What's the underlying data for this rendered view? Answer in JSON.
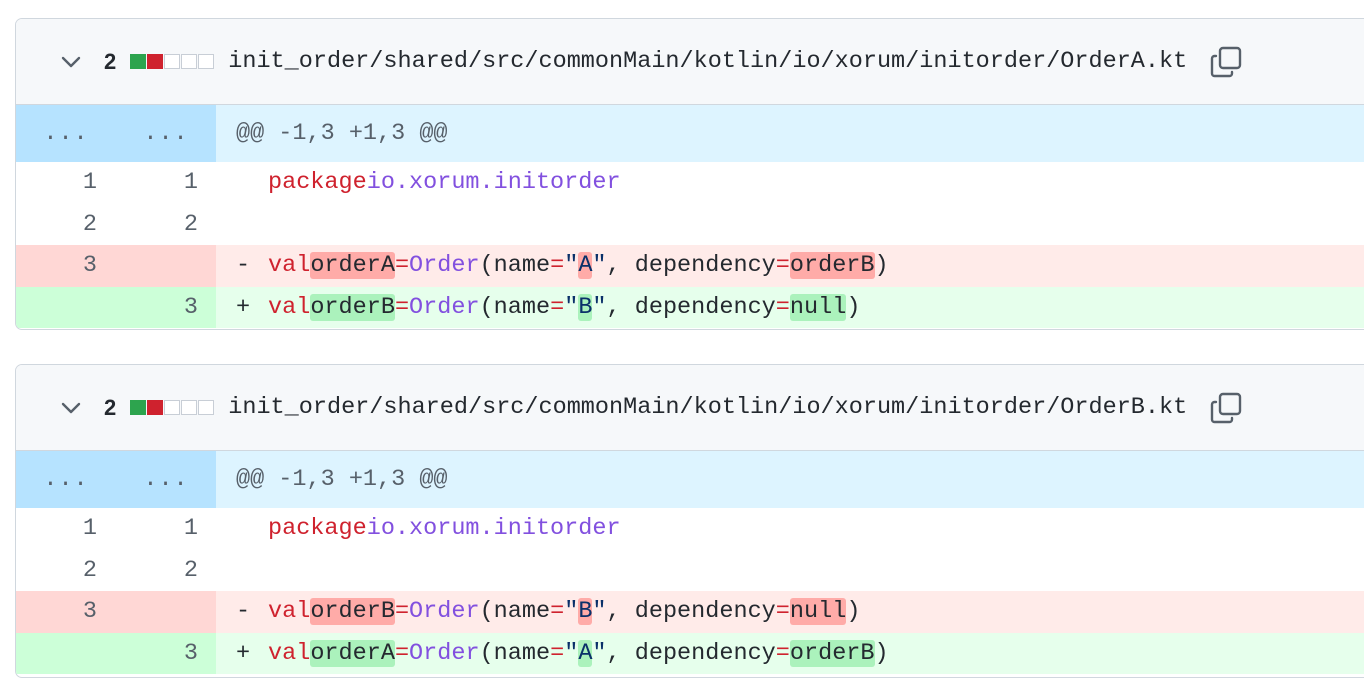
{
  "files": [
    {
      "change_count": "2",
      "diffstat": [
        "add",
        "del",
        "neutral",
        "neutral",
        "neutral"
      ],
      "path": "init_order/shared/src/commonMain/kotlin/io/xorum/initorder/OrderA.kt",
      "copy_icon": "copy-icon",
      "expand_icon": "chevron-down-icon",
      "hunk": {
        "old": "...",
        "new": "...",
        "header": "@@ -1,3 +1,3 @@"
      },
      "lines": [
        {
          "old": "1",
          "new": "1",
          "marker": " ",
          "package_kw": "package",
          "package_name": "io.xorum.initorder"
        },
        {
          "old": "2",
          "new": "2",
          "marker": " "
        },
        {
          "old": "3",
          "new": "",
          "marker": "-",
          "val": "val",
          "name": "orderA",
          "eq": "=",
          "ctor": "Order",
          "arg1": "name",
          "str_q1": "\"",
          "str_v": "A",
          "str_q2": "\"",
          "arg2": "dependency",
          "dep": "orderB",
          "open": "(",
          "close": ")",
          "comma": ", "
        },
        {
          "old": "",
          "new": "3",
          "marker": "+",
          "val": "val",
          "name": "orderB",
          "eq": "=",
          "ctor": "Order",
          "arg1": "name",
          "str_q1": "\"",
          "str_v": "B",
          "str_q2": "\"",
          "arg2": "dependency",
          "dep": "null",
          "open": "(",
          "close": ")",
          "comma": ", "
        }
      ]
    },
    {
      "change_count": "2",
      "diffstat": [
        "add",
        "del",
        "neutral",
        "neutral",
        "neutral"
      ],
      "path": "init_order/shared/src/commonMain/kotlin/io/xorum/initorder/OrderB.kt",
      "copy_icon": "copy-icon",
      "expand_icon": "chevron-down-icon",
      "hunk": {
        "old": "...",
        "new": "...",
        "header": "@@ -1,3 +1,3 @@"
      },
      "lines": [
        {
          "old": "1",
          "new": "1",
          "marker": " ",
          "package_kw": "package",
          "package_name": "io.xorum.initorder"
        },
        {
          "old": "2",
          "new": "2",
          "marker": " "
        },
        {
          "old": "3",
          "new": "",
          "marker": "-",
          "val": "val",
          "name": "orderB",
          "eq": "=",
          "ctor": "Order",
          "arg1": "name",
          "str_q1": "\"",
          "str_v": "B",
          "str_q2": "\"",
          "arg2": "dependency",
          "dep": "null",
          "open": "(",
          "close": ")",
          "comma": ", "
        },
        {
          "old": "",
          "new": "3",
          "marker": "+",
          "val": "val",
          "name": "orderA",
          "eq": "=",
          "ctor": "Order",
          "arg1": "name",
          "str_q1": "\"",
          "str_v": "A",
          "str_q2": "\"",
          "arg2": "dependency",
          "dep": "orderB",
          "open": "(",
          "close": ")",
          "comma": ", "
        }
      ]
    }
  ],
  "colors": {
    "added_block": "#2da44e",
    "deleted_block": "#cf222e",
    "hunk_bg": "#ddf4ff",
    "deletion_bg": "#ffebe9",
    "addition_bg": "#e6ffec"
  }
}
